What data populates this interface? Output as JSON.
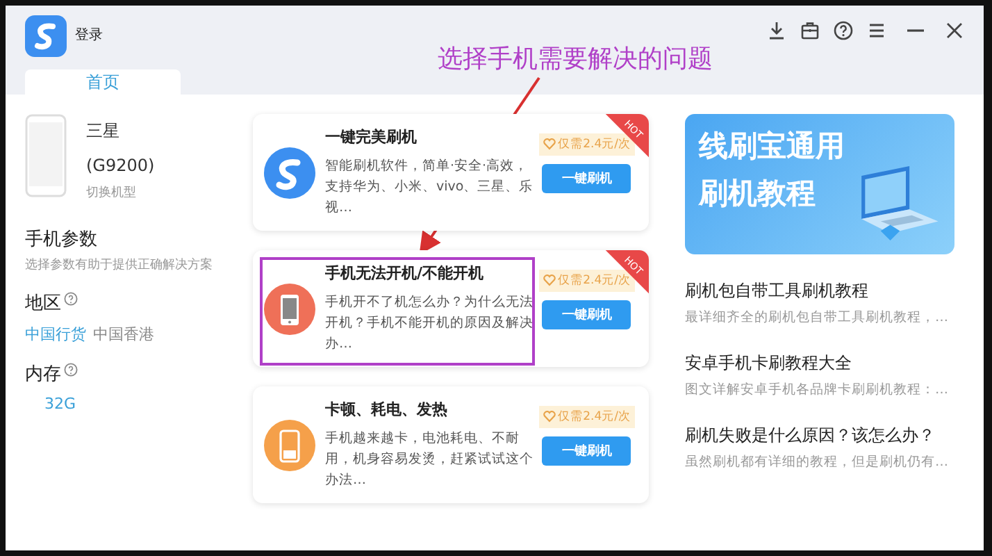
{
  "window": {
    "title": "登录"
  },
  "tabs": [
    {
      "label": "首页",
      "selected": true
    }
  ],
  "device": {
    "brand": "三星",
    "model": "(G9200)",
    "switch_link": "切换机型"
  },
  "params": {
    "title": "手机参数",
    "hint": "选择参数有助于提供正确解决方案",
    "groups": [
      {
        "label": "地区",
        "options": [
          {
            "label": "中国行货",
            "selected": true
          },
          {
            "label": "中国香港",
            "selected": false
          }
        ]
      },
      {
        "label": "内存",
        "options": [
          {
            "label": "32G",
            "selected": true
          }
        ]
      }
    ]
  },
  "annotation": {
    "text": "选择手机需要解决的问题"
  },
  "solutions": [
    {
      "kind": "logo",
      "badge": "HOT",
      "highlighted": false,
      "title": "一键完美刷机",
      "desc": "智能刷机软件，简单·安全·高效，支持华为、小米、vivo、三星、乐视…",
      "price": "仅需2.4元/次",
      "button": "一键刷机"
    },
    {
      "kind": "phone",
      "badge": "HOT",
      "highlighted": true,
      "title": "手机无法开机/不能开机",
      "desc": "手机开不了机怎么办？为什么无法开机？手机不能开机的原因及解决办…",
      "price": "仅需2.4元/次",
      "button": "一键刷机"
    },
    {
      "kind": "battery",
      "highlighted": false,
      "title": "卡顿、耗电、发热",
      "desc": "手机越来越卡，电池耗电、不耐用，机身容易发烫，赶紧试试这个办法…",
      "price": "仅需2.4元/次",
      "button": "一键刷机"
    }
  ],
  "banner": {
    "lines": [
      "线刷宝通用",
      "刷机教程"
    ]
  },
  "articles": [
    {
      "title": "刷机包自带工具刷机教程",
      "summary": "最详细齐全的刷机包自带工具刷机教程，…"
    },
    {
      "title": "安卓手机卡刷教程大全",
      "summary": "图文详解安卓手机各品牌卡刷刷机教程：…"
    },
    {
      "title": "刷机失败是什么原因？该怎么办？",
      "summary": "虽然刷机都有详细的教程，但是刷机仍有…"
    }
  ]
}
